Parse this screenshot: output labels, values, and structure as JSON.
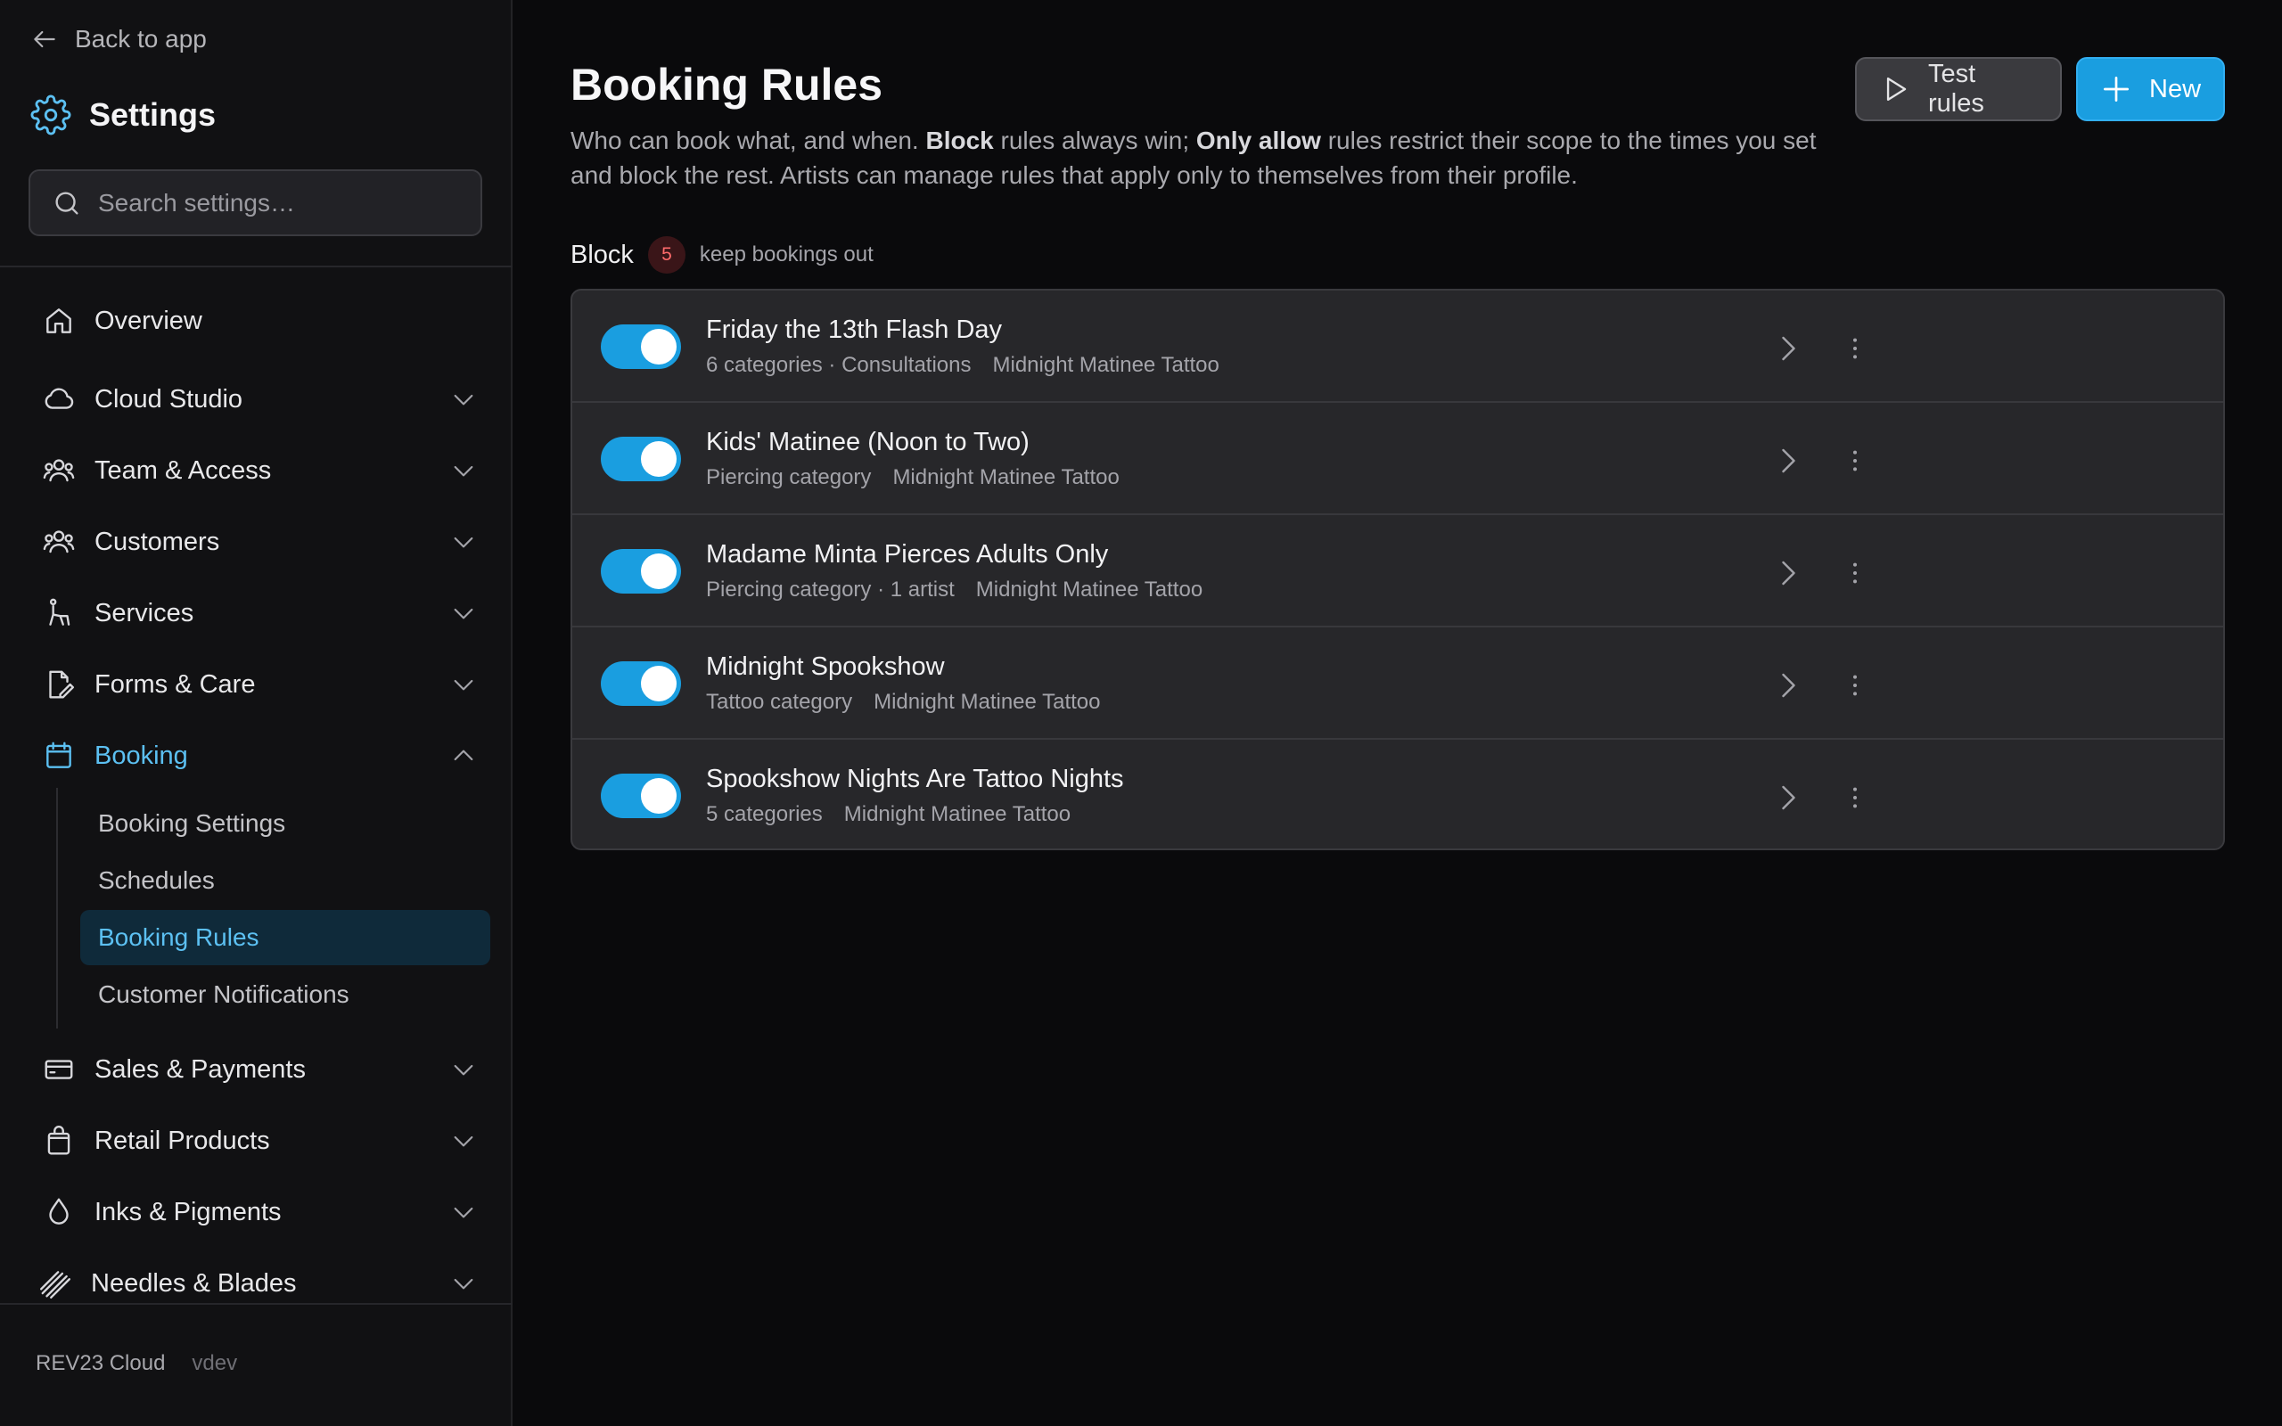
{
  "sidebar": {
    "back_label": "Back to app",
    "title": "Settings",
    "search_placeholder": "Search settings…",
    "nav": [
      {
        "label": "Overview",
        "icon": "home-icon"
      },
      {
        "label": "Cloud Studio",
        "icon": "cloud-icon"
      },
      {
        "label": "Team & Access",
        "icon": "users-icon"
      },
      {
        "label": "Customers",
        "icon": "users-icon"
      },
      {
        "label": "Services",
        "icon": "chair-icon"
      },
      {
        "label": "Forms & Care",
        "icon": "form-edit-icon"
      },
      {
        "label": "Booking",
        "icon": "calendar-icon"
      },
      {
        "label": "Sales & Payments",
        "icon": "credit-card-icon"
      },
      {
        "label": "Retail Products",
        "icon": "shopping-bag-icon"
      },
      {
        "label": "Inks & Pigments",
        "icon": "droplet-icon"
      },
      {
        "label": "Needles & Blades",
        "icon": "needles-icon"
      }
    ],
    "booking_sub": [
      {
        "label": "Booking Settings"
      },
      {
        "label": "Schedules"
      },
      {
        "label": "Booking Rules"
      },
      {
        "label": "Customer Notifications"
      }
    ],
    "footer": {
      "brand": "REV23 Cloud",
      "version": "vdev"
    }
  },
  "main": {
    "title": "Booking Rules",
    "desc": {
      "p1": "Who can book what, and when. ",
      "b1": "Block",
      "p2": " rules always win; ",
      "b2": "Only allow",
      "p3": " rules restrict their scope to the times you set and block the rest. Artists can manage rules that apply only to themselves from their profile."
    },
    "test_label": "Test rules",
    "new_label": "New",
    "section": {
      "label": "Block",
      "count": "5",
      "hint": "keep bookings out"
    },
    "rules": [
      {
        "name": "Friday the 13th Flash Day",
        "scope": "6 categories · Consultations",
        "location": "Midnight Matinee Tattoo",
        "enabled": true
      },
      {
        "name": "Kids' Matinee (Noon to Two)",
        "scope": "Piercing category",
        "location": "Midnight Matinee Tattoo",
        "enabled": true
      },
      {
        "name": "Madame Minta Pierces Adults Only",
        "scope": "Piercing category · 1 artist",
        "location": "Midnight Matinee Tattoo",
        "enabled": true
      },
      {
        "name": "Midnight Spookshow",
        "scope": "Tattoo category",
        "location": "Midnight Matinee Tattoo",
        "enabled": true
      },
      {
        "name": "Spookshow Nights Are Tattoo Nights",
        "scope": "5 categories",
        "location": "Midnight Matinee Tattoo",
        "enabled": true
      }
    ]
  },
  "colors": {
    "accent": "#1a9ee0",
    "active_text": "#5cc0f2",
    "badge_text": "#ff6b6b"
  }
}
